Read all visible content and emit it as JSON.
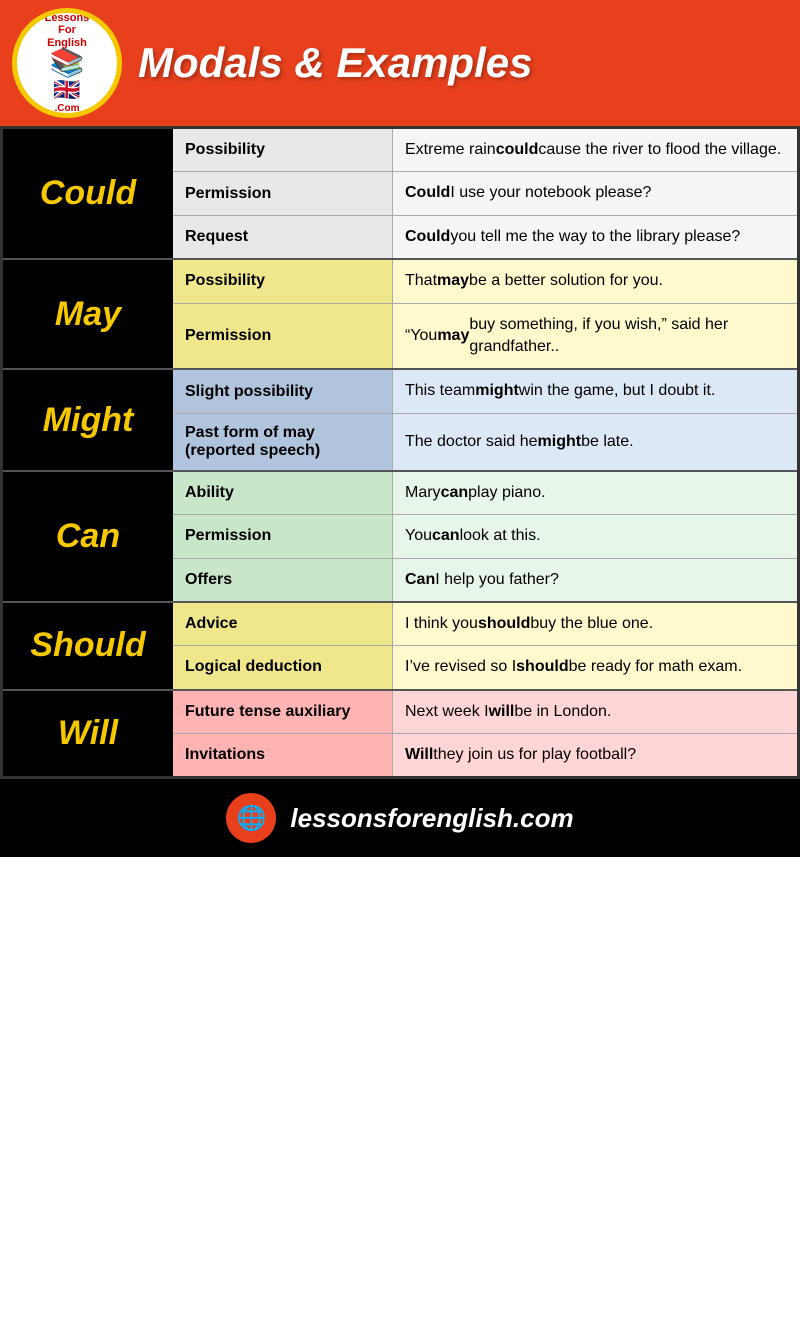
{
  "header": {
    "title": "Modals & Examples",
    "logo_top": "LessonsForEnglish",
    "logo_bottom": ".Com"
  },
  "footer": {
    "url": "lessonsforenglish.com"
  },
  "modals": [
    {
      "label": "Could",
      "rows": [
        {
          "usage": "Possibility",
          "example_plain": "Extreme rain ",
          "example_bold": "could",
          "example_rest": " cause the river to flood the village."
        },
        {
          "usage": "Permission",
          "example_plain": "",
          "example_bold": "Could",
          "example_rest": " I use your notebook please?"
        },
        {
          "usage": "Request",
          "example_plain": "",
          "example_bold": "Could",
          "example_rest": " you tell me the way to the library please?"
        }
      ]
    },
    {
      "label": "May",
      "rows": [
        {
          "usage": "Possibility",
          "example_plain": "That ",
          "example_bold": "may",
          "example_rest": " be a better solution for you."
        },
        {
          "usage": "Permission",
          "example_plain": "“You ",
          "example_bold": "may",
          "example_rest": " buy something, if you wish,” said her grandfather.."
        }
      ]
    },
    {
      "label": "Might",
      "rows": [
        {
          "usage": "Slight possibility",
          "example_plain": "This team ",
          "example_bold": "might",
          "example_rest": " win the game, but I doubt it."
        },
        {
          "usage": "Past form of may (reported speech)",
          "example_plain": "The doctor said he ",
          "example_bold": "might",
          "example_rest": " be late."
        }
      ]
    },
    {
      "label": "Can",
      "rows": [
        {
          "usage": "Ability",
          "example_plain": "Mary ",
          "example_bold": "can",
          "example_rest": " play piano."
        },
        {
          "usage": "Permission",
          "example_plain": "You ",
          "example_bold": "can",
          "example_rest": " look at this."
        },
        {
          "usage": "Offers",
          "example_plain": "",
          "example_bold": "Can",
          "example_rest": " I help you father?"
        }
      ]
    },
    {
      "label": "Should",
      "rows": [
        {
          "usage": "Advice",
          "example_plain": "I think you ",
          "example_bold": "should",
          "example_rest": " buy the blue one."
        },
        {
          "usage": "Logical deduction",
          "example_plain": "I’ve revised so I ",
          "example_bold": "should",
          "example_rest": " be ready for math exam."
        }
      ]
    },
    {
      "label": "Will",
      "rows": [
        {
          "usage": "Future tense auxiliary",
          "example_plain": "Next week I ",
          "example_bold": "will",
          "example_rest": " be in London."
        },
        {
          "usage": "Invitations",
          "example_plain": "",
          "example_bold": "Will",
          "example_rest": " they join us for play football?"
        }
      ]
    }
  ]
}
